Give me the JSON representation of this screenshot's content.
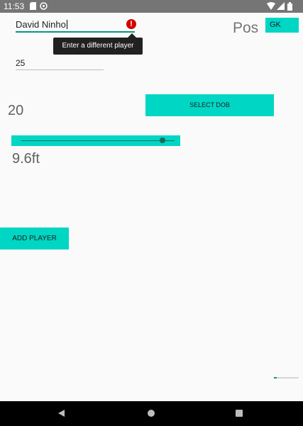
{
  "status_bar": {
    "time": "11:53",
    "icons": [
      "sd-card-icon",
      "sync-icon",
      "wifi-icon",
      "signal-icon",
      "battery-icon"
    ]
  },
  "form": {
    "name_value": "David Ninho",
    "name_error": "Enter a different player",
    "position_label": "Pos",
    "position_value": "GK",
    "number_value": "25",
    "age_value": "20",
    "dob_button": "SELECT DOB",
    "height_slider_level": 0.92,
    "height_value": "9.6ft",
    "add_button": "ADD PLAYER"
  },
  "progress": {
    "fraction": 0.1
  },
  "colors": {
    "accent": "#00d6c4",
    "primary": "#009688",
    "error": "#d50000"
  }
}
